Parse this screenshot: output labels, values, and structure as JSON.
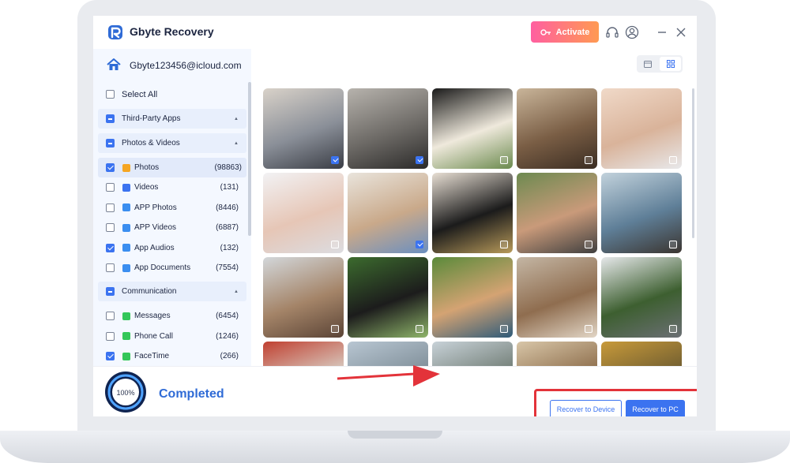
{
  "app": {
    "title": "Gbyte Recovery",
    "activate_label": "Activate",
    "account_email": "Gbyte123456@icloud.com",
    "brand_color": "#3b73f0"
  },
  "header_icons": [
    "key-icon",
    "headset-icon",
    "user-icon",
    "minimize-icon",
    "close-icon"
  ],
  "view_toggle": [
    "calendar-icon",
    "grid-view-icon"
  ],
  "sidebar": {
    "select_all": "Select All",
    "groups": [
      {
        "label": "Third-Party Apps",
        "state": "partial",
        "expanded": true,
        "items": []
      },
      {
        "label": "Photos & Videos",
        "state": "partial",
        "expanded": true,
        "items": [
          {
            "label": "Photos",
            "count": "(98863)",
            "checked": true,
            "active": true,
            "icon": "photos-icon",
            "color": "#f5a623"
          },
          {
            "label": "Videos",
            "count": "(131)",
            "checked": false,
            "icon": "videos-icon",
            "color": "#3b73f0"
          },
          {
            "label": "APP Photos",
            "count": "(8446)",
            "checked": false,
            "icon": "app-photos-icon",
            "color": "#3b8ef0"
          },
          {
            "label": "APP Videos",
            "count": "(6887)",
            "checked": false,
            "icon": "app-videos-icon",
            "color": "#3b8ef0"
          },
          {
            "label": "App Audios",
            "count": "(132)",
            "checked": true,
            "icon": "app-audios-icon",
            "color": "#3b8ef0"
          },
          {
            "label": "App Documents",
            "count": "(7554)",
            "checked": false,
            "icon": "app-documents-icon",
            "color": "#3b8ef0"
          }
        ]
      },
      {
        "label": "Communication",
        "state": "partial",
        "expanded": true,
        "items": [
          {
            "label": "Messages",
            "count": "(6454)",
            "checked": false,
            "icon": "messages-icon",
            "color": "#34c759"
          },
          {
            "label": "Phone Call",
            "count": "(1246)",
            "checked": false,
            "icon": "phone-call-icon",
            "color": "#34c759"
          },
          {
            "label": "FaceTime",
            "count": "(266)",
            "checked": true,
            "icon": "facetime-icon",
            "color": "#34c759"
          }
        ]
      }
    ]
  },
  "photos": [
    {
      "name": "wedding-couple",
      "checked": true,
      "colors": [
        "#d9d2c9",
        "#8a8f98",
        "#3a3d45"
      ]
    },
    {
      "name": "silhouette-couple",
      "checked": true,
      "colors": [
        "#b7b3ad",
        "#6d6a66",
        "#2b2a29"
      ]
    },
    {
      "name": "white-flowers",
      "checked": false,
      "colors": [
        "#1a1a1a",
        "#efe9dc",
        "#6b8a4e"
      ]
    },
    {
      "name": "balcony-cafe",
      "checked": false,
      "colors": [
        "#c9b59a",
        "#7a5e45",
        "#3b2d22"
      ]
    },
    {
      "name": "baby-smiling",
      "checked": false,
      "colors": [
        "#f0d9c8",
        "#d9b39a",
        "#e8e8ea"
      ]
    },
    {
      "name": "baby-feet",
      "checked": false,
      "colors": [
        "#f2f2f4",
        "#e6c6b6",
        "#dcdce0"
      ]
    },
    {
      "name": "toddler-kitchen",
      "checked": true,
      "colors": [
        "#e9e4dc",
        "#c9a98a",
        "#6a8fc0"
      ]
    },
    {
      "name": "graduation-cap",
      "checked": false,
      "colors": [
        "#e8dfd4",
        "#1b1b1b",
        "#b89a5a"
      ]
    },
    {
      "name": "family-selfie",
      "checked": false,
      "colors": [
        "#6d8a50",
        "#c99a7a",
        "#3f3f3f"
      ]
    },
    {
      "name": "family-beach",
      "checked": false,
      "colors": [
        "#c2d2dc",
        "#5f7f98",
        "#3b3530"
      ]
    },
    {
      "name": "mother-child-beach",
      "checked": false,
      "colors": [
        "#d3d7da",
        "#a48468",
        "#5b4436"
      ]
    },
    {
      "name": "father-kids-park",
      "checked": false,
      "colors": [
        "#3c6b2e",
        "#1c1c1c",
        "#8fb56a"
      ]
    },
    {
      "name": "piggyback-smile",
      "checked": false,
      "colors": [
        "#5a8a3a",
        "#d4a373",
        "#2f5b7a"
      ]
    },
    {
      "name": "jumping-dunes",
      "checked": false,
      "colors": [
        "#c4b6a4",
        "#8f6d4f",
        "#e2d6c6"
      ]
    },
    {
      "name": "palm-tree-car",
      "checked": false,
      "colors": [
        "#e6e8ea",
        "#3d5f30",
        "#6b6f74"
      ]
    },
    {
      "name": "street-sign",
      "checked": false,
      "colors": [
        "#c04030",
        "#d9d2c8",
        "#5a4a40"
      ]
    },
    {
      "name": "mountains",
      "checked": false,
      "colors": [
        "#b8c6d2",
        "#7d8c96",
        "#e4e8ec"
      ]
    },
    {
      "name": "hills-sky",
      "checked": false,
      "colors": [
        "#c8d2d8",
        "#6e7a72",
        "#e2e6e8"
      ]
    },
    {
      "name": "window-light",
      "checked": false,
      "colors": [
        "#d8c6a8",
        "#8a6a48",
        "#f0e6d4"
      ]
    },
    {
      "name": "autumn-trees",
      "checked": false,
      "colors": [
        "#c89a3a",
        "#6b5a30",
        "#e0c890"
      ]
    }
  ],
  "status": {
    "progress": 100,
    "progress_text": "100%",
    "completed_label": "Completed"
  },
  "actions": {
    "recover_device": "Recover to Device",
    "recover_pc": "Recover to PC",
    "highlight_color": "#e3333a"
  }
}
